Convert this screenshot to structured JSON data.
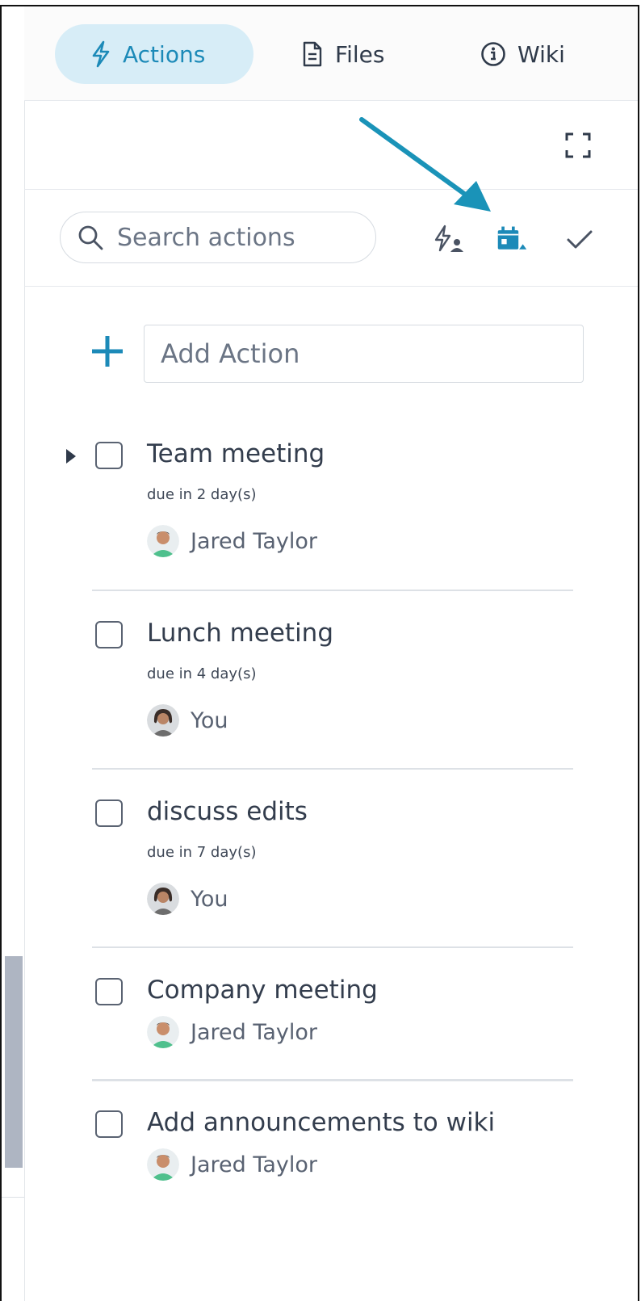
{
  "tabs": [
    {
      "label": "Actions",
      "icon": "lightning-icon",
      "active": true
    },
    {
      "label": "Files",
      "icon": "file-icon",
      "active": false
    },
    {
      "label": "Wiki",
      "icon": "info-icon",
      "active": false
    }
  ],
  "toolbar": {
    "expand_icon": "expand-icon",
    "search_placeholder": "Search actions",
    "buttons": [
      "assign-filter-icon",
      "due-date-sort-icon",
      "completed-check-icon"
    ]
  },
  "add_action": {
    "placeholder": "Add Action"
  },
  "actions": [
    {
      "title": "Team meeting",
      "due": "due in 2 day(s)",
      "assignee": "Jared Taylor",
      "avatar": "male",
      "expandable": true
    },
    {
      "title": "Lunch meeting",
      "due": "due in 4 day(s)",
      "assignee": "You",
      "avatar": "female",
      "expandable": false
    },
    {
      "title": "discuss edits",
      "due": "due in 7 day(s)",
      "assignee": "You",
      "avatar": "female",
      "expandable": false
    },
    {
      "title": "Company meeting",
      "due": "",
      "assignee": "Jared Taylor",
      "avatar": "male",
      "expandable": false
    },
    {
      "title": "Add announcements to wiki",
      "due": "",
      "assignee": "Jared Taylor",
      "avatar": "male",
      "expandable": false
    }
  ],
  "colors": {
    "accent": "#1c8ab8",
    "active_tab_bg": "#d7edf7",
    "annotation_arrow": "#1a93b8"
  }
}
